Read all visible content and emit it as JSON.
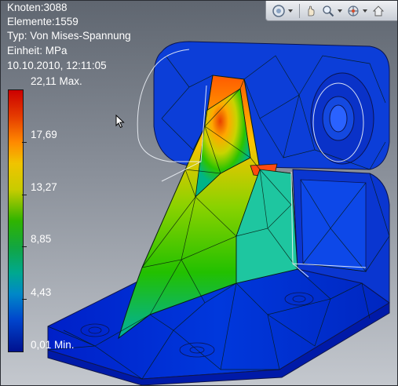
{
  "info": {
    "nodes": "Knoten:3088",
    "elements": "Elemente:1559",
    "type": "Typ: Von Mises-Spannung",
    "unit": "Einheit: MPa",
    "timestamp": "10.10.2010, 12:11:05"
  },
  "legend": {
    "max_label": "22,11 Max.",
    "labels": [
      "17,69",
      "13,27",
      "8,85",
      "4,43"
    ],
    "min_label": "0,01 Min.",
    "max_value": 22.11,
    "min_value": 0.01,
    "colors": [
      "#cc0000",
      "#ff8a00",
      "#f0c400",
      "#2fb400",
      "#00a890",
      "#0044cc",
      "#00118f"
    ]
  },
  "toolbar": {
    "icons": [
      "orbit-icon",
      "pan-icon",
      "zoom-icon",
      "look-at-icon",
      "home-view-icon"
    ]
  }
}
